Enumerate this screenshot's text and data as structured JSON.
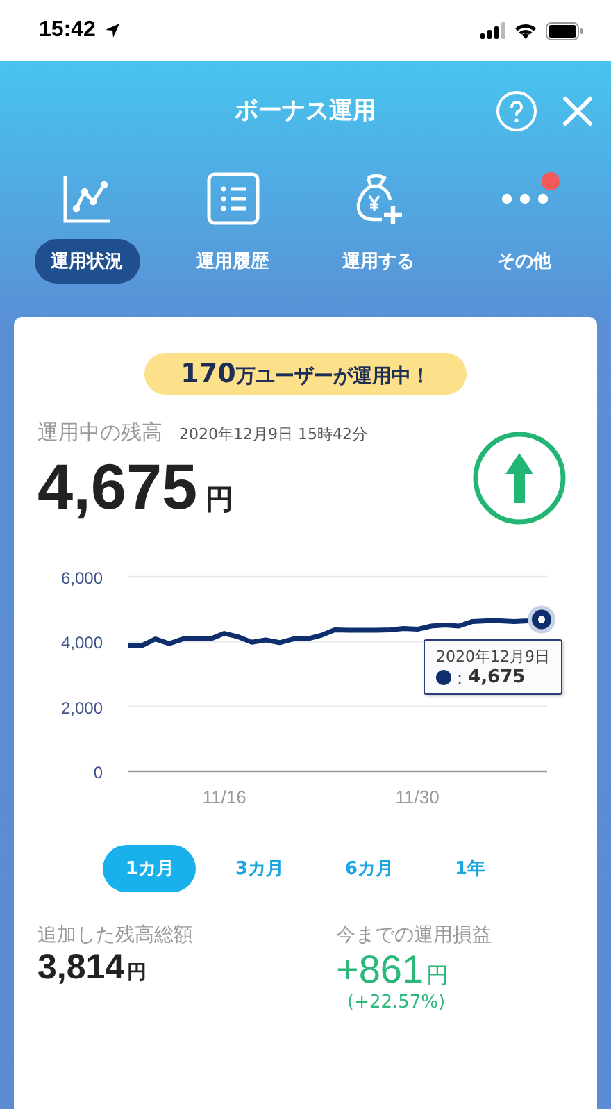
{
  "status_bar": {
    "time": "15:42"
  },
  "header": {
    "title": "ボーナス運用"
  },
  "nav": [
    {
      "label": "運用状況",
      "selected": true,
      "notification": false
    },
    {
      "label": "運用履歴",
      "selected": false,
      "notification": false
    },
    {
      "label": "運用する",
      "selected": false,
      "notification": false
    },
    {
      "label": "その他",
      "selected": false,
      "notification": true
    }
  ],
  "banner": {
    "count": "170",
    "text": "万ユーザーが運用中！"
  },
  "balance": {
    "label": "運用中の残高",
    "timestamp": "2020年12月9日 15時42分",
    "amount": "4,675",
    "unit": "円",
    "rising": true
  },
  "chart_data": {
    "type": "line",
    "categories": [
      null,
      null,
      null,
      null,
      null,
      null,
      null,
      "11/16",
      null,
      null,
      null,
      null,
      null,
      null,
      null,
      null,
      null,
      null,
      null,
      null,
      null,
      "11/30",
      null,
      null,
      null,
      null,
      null,
      null,
      null,
      null,
      null
    ],
    "series": [
      {
        "color": "#0f2e6e",
        "values": [
          3870,
          3870,
          4080,
          3940,
          4080,
          4080,
          4080,
          4250,
          4150,
          3980,
          4050,
          3970,
          4080,
          4080,
          4190,
          4360,
          4350,
          4350,
          4350,
          4360,
          4400,
          4380,
          4480,
          4510,
          4480,
          4620,
          4640,
          4640,
          4620,
          4640,
          4680
        ]
      }
    ],
    "ylim": [
      0,
      6000
    ],
    "yticks": [
      {
        "value": 0,
        "label": "0"
      },
      {
        "value": 2000,
        "label": "2,000"
      },
      {
        "value": 4000,
        "label": "4,000"
      },
      {
        "value": 6000,
        "label": "6,000"
      }
    ]
  },
  "tooltip": {
    "date": "2020年12月9日",
    "separator": ":",
    "value": "4,675"
  },
  "periods": [
    {
      "label": "1カ月",
      "selected": true
    },
    {
      "label": "3カ月",
      "selected": false
    },
    {
      "label": "6カ月",
      "selected": false
    },
    {
      "label": "1年",
      "selected": false
    }
  ],
  "summary": [
    {
      "kind": "plain",
      "label": "追加した残高総額",
      "amount": "3,814",
      "unit": "円"
    },
    {
      "kind": "gain",
      "label": "今までの運用損益",
      "amount": "+861",
      "unit": "円",
      "change": "(+22.57%)"
    }
  ]
}
